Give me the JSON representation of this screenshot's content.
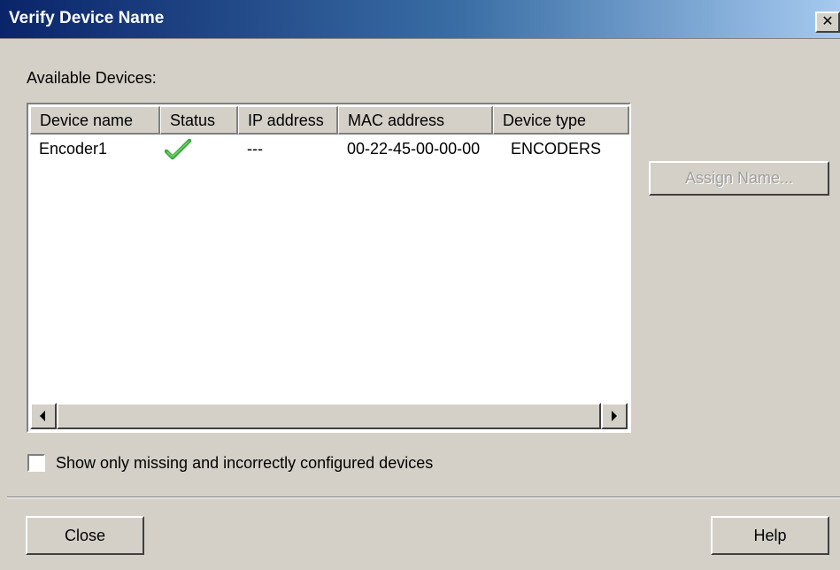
{
  "window": {
    "title": "Verify Device Name",
    "close_glyph": "✕"
  },
  "available_label": "Available Devices:",
  "table": {
    "columns": [
      "Device name",
      "Status",
      "IP address",
      "MAC address",
      "Device type"
    ],
    "rows": [
      {
        "device_name": "Encoder1",
        "status_icon": "green-checkmark-icon",
        "ip_address": "---",
        "mac_address": "00-22-45-00-00-00",
        "device_type": "ENCODERS"
      }
    ]
  },
  "buttons": {
    "assign_name": "Assign Name...",
    "close": "Close",
    "help": "Help"
  },
  "filter_checkbox": {
    "label": "Show only missing and incorrectly configured devices",
    "checked": false
  },
  "colors": {
    "title_gradient_start": "#0a246a",
    "title_gradient_end": "#a6caf0",
    "status_ok": "#3aa93a"
  }
}
